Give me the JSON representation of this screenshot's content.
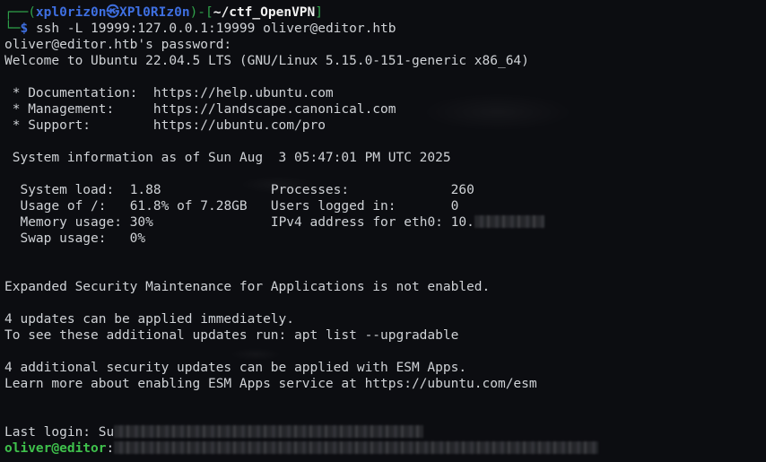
{
  "prompt": {
    "box_top": "┌──(",
    "user_host": "xpl0riz0n㉿XPl0RIz0n",
    "mid": ")-[",
    "dir": "~/ctf_OpenVPN",
    "end": "]",
    "box_bottom": "└─",
    "symbol": "$",
    "command": "ssh -L 19999:127.0.0.1:19999 oliver@editor.htb"
  },
  "output": {
    "password_prompt": "oliver@editor.htb's password:",
    "welcome": "Welcome to Ubuntu 22.04.5 LTS (GNU/Linux 5.15.0-151-generic x86_64)",
    "links": [
      {
        "label": " * Documentation:  ",
        "url": "https://help.ubuntu.com"
      },
      {
        "label": " * Management:     ",
        "url": "https://landscape.canonical.com"
      },
      {
        "label": " * Support:        ",
        "url": "https://ubuntu.com/pro"
      }
    ],
    "sysinfo_header": " System information as of Sun Aug  3 05:47:01 PM UTC 2025",
    "sysinfo": [
      {
        "left_key": "  System load:  ",
        "left_val": "1.88",
        "left_pad": "              ",
        "right_key": "Processes:             ",
        "right_val": "260"
      },
      {
        "left_key": "  Usage of /:   ",
        "left_val": "61.8% of 7.28GB",
        "left_pad": "   ",
        "right_key": "Users logged in:       ",
        "right_val": "0"
      },
      {
        "left_key": "  Memory usage: ",
        "left_val": "30%",
        "left_pad": "               ",
        "right_key": "IPv4 address for eth0: ",
        "right_val": "10."
      }
    ],
    "swap": "  Swap usage:   0%",
    "esm_status": "Expanded Security Maintenance for Applications is not enabled.",
    "updates_count": "4 updates can be applied immediately.",
    "updates_hint": "To see these additional updates run: apt list --upgradable",
    "esm_updates": "4 additional security updates can be applied with ESM Apps.",
    "esm_learn": "Learn more about enabling ESM Apps service at https://ubuntu.com/esm",
    "last_login": "Last login: Su",
    "remote_prompt_user": "oliver@editor",
    "remote_prompt_colon": ":"
  }
}
